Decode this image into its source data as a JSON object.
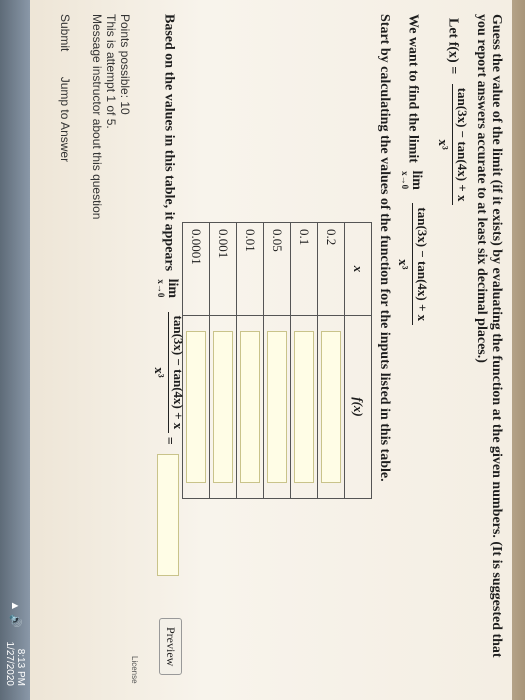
{
  "question": {
    "intro": "Guess the value of the limit (if it exists) by evaluating the function at the given numbers. (It is suggested that you report answers accurate to at least six decimal places.)",
    "let_label": "Let f(x) =",
    "numerator": "tan(3x) − tan(4x) + x",
    "denominator": "x³",
    "goal_label": "We want to find the limit",
    "lim_word": "lim",
    "lim_sub": "x→0",
    "start_text": "Start by calculating the values of the function for the inputs listed in this table."
  },
  "table": {
    "headers": [
      "x",
      "f(x)"
    ],
    "rows": [
      {
        "x": "0.2"
      },
      {
        "x": "0.1"
      },
      {
        "x": "0.05"
      },
      {
        "x": "0.01"
      },
      {
        "x": "0.001"
      },
      {
        "x": "0.0001"
      }
    ]
  },
  "result": {
    "text": "Based on the values in this table, it appears",
    "equals": "="
  },
  "preview_label": "Preview",
  "points": {
    "possible": "Points possible: 10",
    "attempt": "This is attempt 1 of 5.",
    "message": "Message instructor about this question"
  },
  "actions": {
    "submit": "Submit",
    "jump": "Jump to Answer"
  },
  "license": "License",
  "taskbar": {
    "time": "8:13 PM",
    "date": "1/27/2020"
  }
}
